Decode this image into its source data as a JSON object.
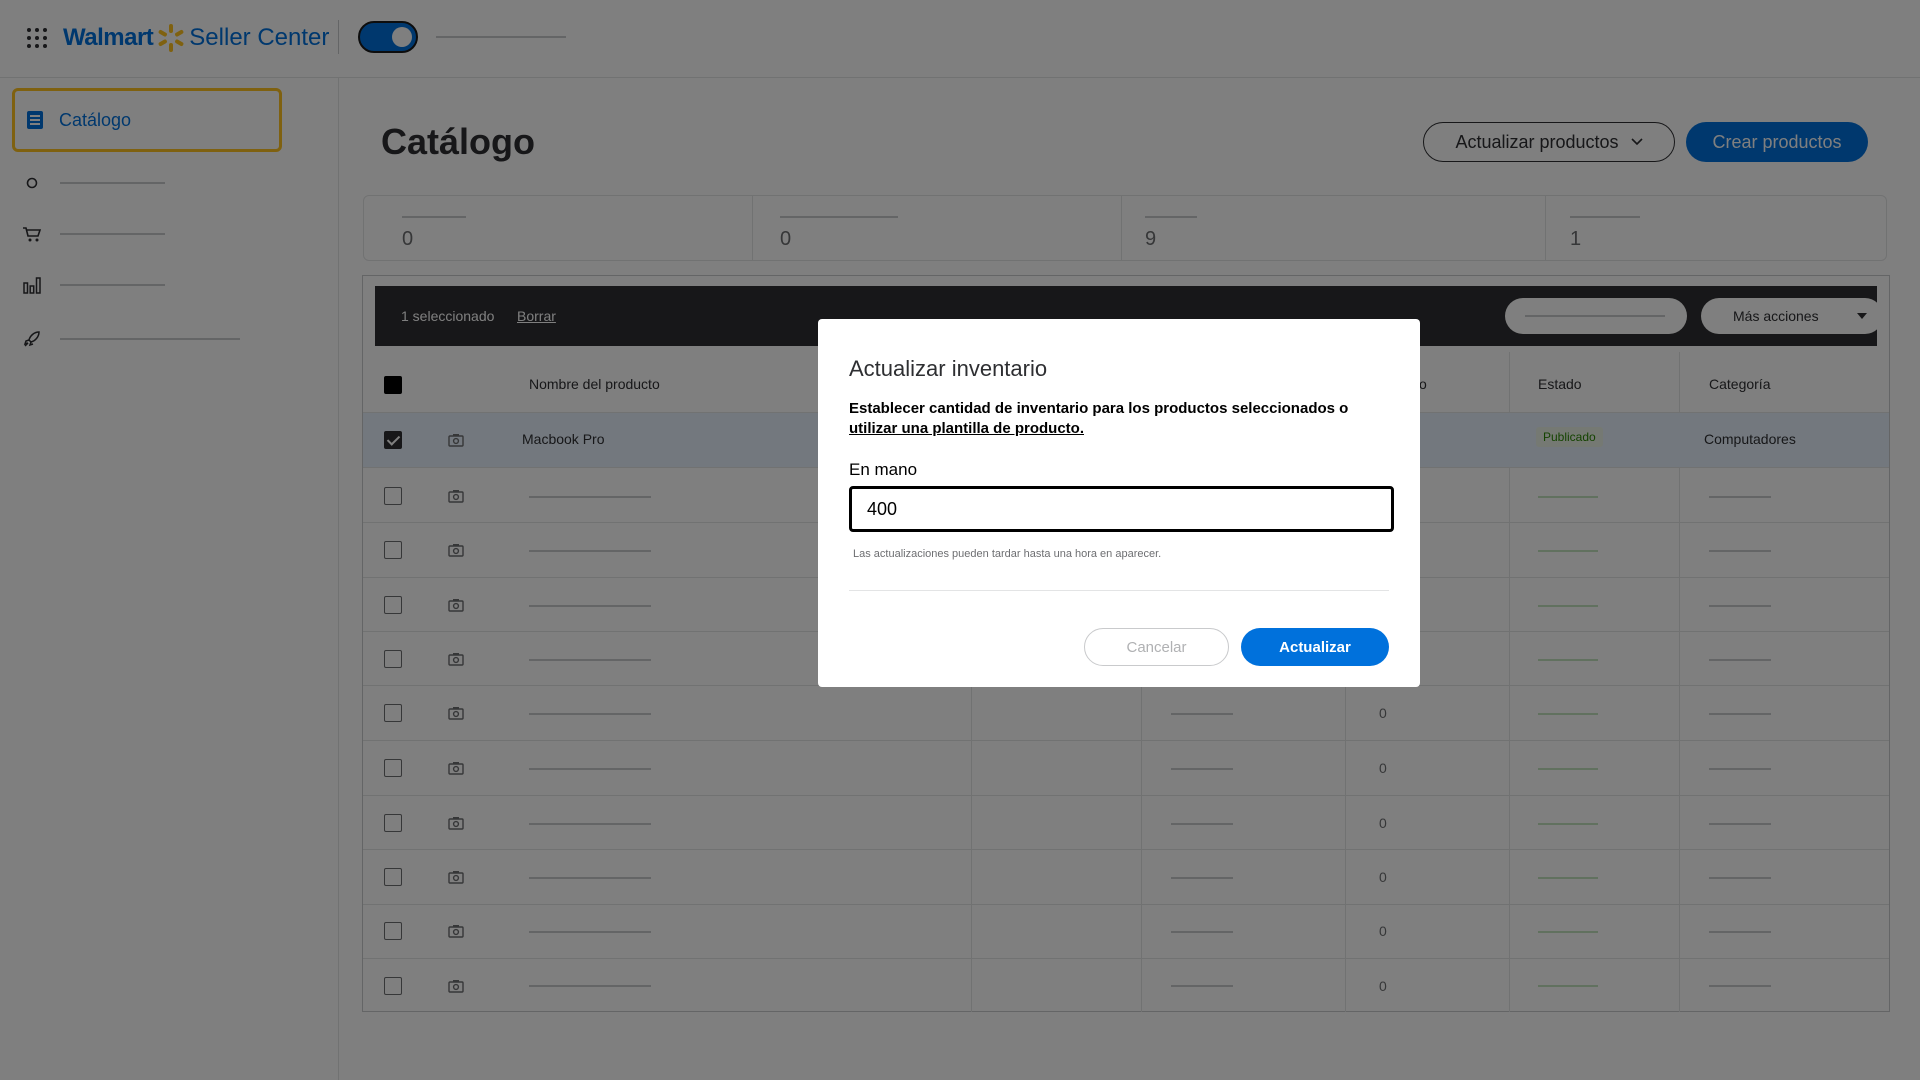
{
  "header": {
    "brand_walmart": "Walmart",
    "brand_seller_center": "Seller Center",
    "toggle_on": true
  },
  "sidebar": {
    "items": [
      {
        "label": "Catálogo",
        "icon": "catalog-icon",
        "active": true
      },
      {
        "label": "",
        "icon": "circle-icon"
      },
      {
        "label": "",
        "icon": "cart-icon"
      },
      {
        "label": "",
        "icon": "bar-chart-icon"
      },
      {
        "label": "",
        "icon": "rocket-icon"
      }
    ]
  },
  "main": {
    "title": "Catálogo",
    "update_products_label": "Actualizar productos",
    "create_products_label": "Crear productos",
    "stats": [
      {
        "value": "0"
      },
      {
        "value": "0"
      },
      {
        "value": "9"
      },
      {
        "value": "1"
      }
    ]
  },
  "table": {
    "selection_bar": {
      "count": "1 seleccionado",
      "clear": "Borrar",
      "more_actions": "Más acciones"
    },
    "columns": {
      "product_name": "Nombre del producto",
      "status": "Estado",
      "category": "Categoría",
      "partial_header": "o"
    },
    "selected_row": {
      "name": "Macbook Pro",
      "status": "Publicado",
      "category": "Computadores"
    },
    "zero_value": "0"
  },
  "modal": {
    "title": "Actualizar inventario",
    "description_text": "Establecer cantidad de inventario para los productos seleccionados o ",
    "description_link": "utilizar una plantilla de producto.",
    "field_label": "En mano",
    "field_value": "400",
    "help_text": "Las actualizaciones pueden tardar hasta una hora en aparecer.",
    "cancel_label": "Cancelar",
    "update_label": "Actualizar"
  },
  "colors": {
    "accent": "#0071dc",
    "highlight": "#ffc220",
    "success": "#2a8703"
  }
}
